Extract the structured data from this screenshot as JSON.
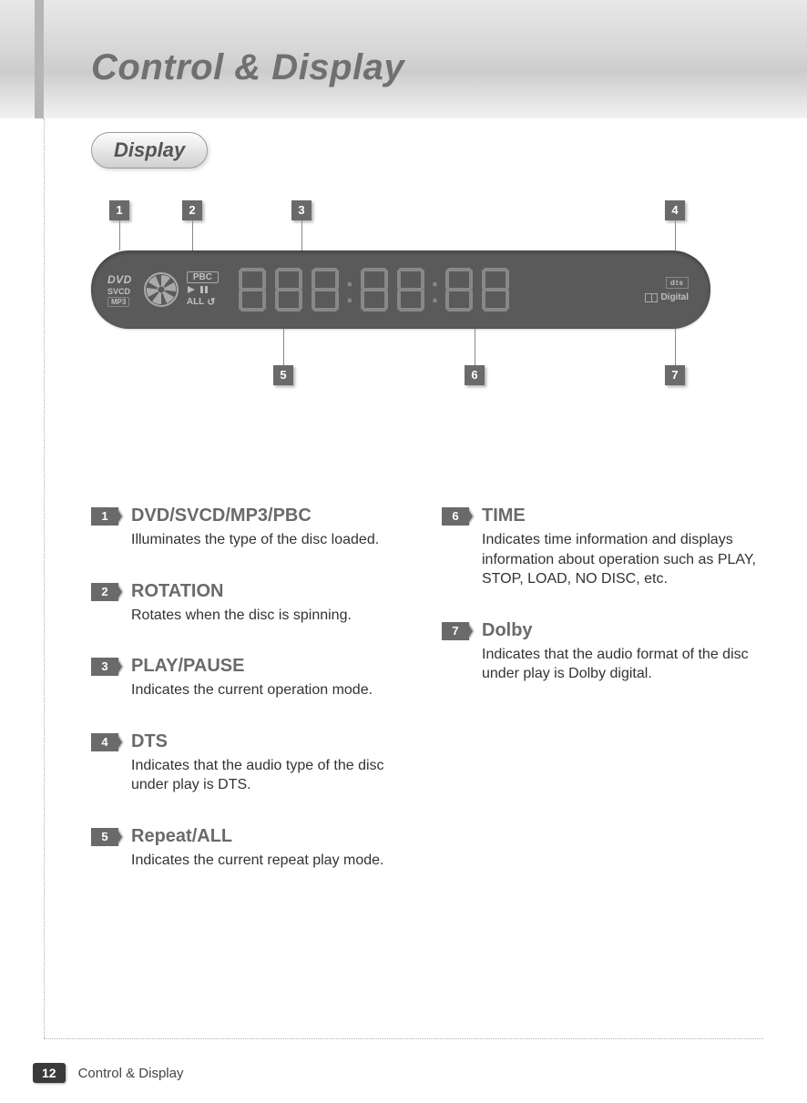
{
  "page": {
    "title": "Control & Display",
    "section_label": "Display",
    "page_number": "12",
    "footer_text": "Control & Display"
  },
  "diagram": {
    "callouts_top": [
      "1",
      "2",
      "3",
      "4"
    ],
    "callouts_bottom": [
      "5",
      "6",
      "7"
    ],
    "lcd": {
      "dvd": "DVD",
      "svcd": "SVCD",
      "mp3": "MP3",
      "pbc": "PBC",
      "all": "ALL",
      "dts": "dts",
      "digital": "Digital"
    }
  },
  "items_left": [
    {
      "num": "1",
      "title": "DVD/SVCD/MP3/PBC",
      "desc": "Illuminates the type of the disc loaded."
    },
    {
      "num": "2",
      "title": "ROTATION",
      "desc": "Rotates when the disc is spinning."
    },
    {
      "num": "3",
      "title": "PLAY/PAUSE",
      "desc": "Indicates the current operation mode."
    },
    {
      "num": "4",
      "title": "DTS",
      "desc": "Indicates that the audio type of the disc under play is DTS."
    },
    {
      "num": "5",
      "title": "Repeat/ALL",
      "desc": "Indicates the current repeat play mode."
    }
  ],
  "items_right": [
    {
      "num": "6",
      "title": "TIME",
      "desc": "Indicates time information and displays information about operation such as PLAY, STOP, LOAD, NO DISC, etc."
    },
    {
      "num": "7",
      "title": "Dolby",
      "desc": "Indicates that the audio format of the disc under play is Dolby digital."
    }
  ]
}
